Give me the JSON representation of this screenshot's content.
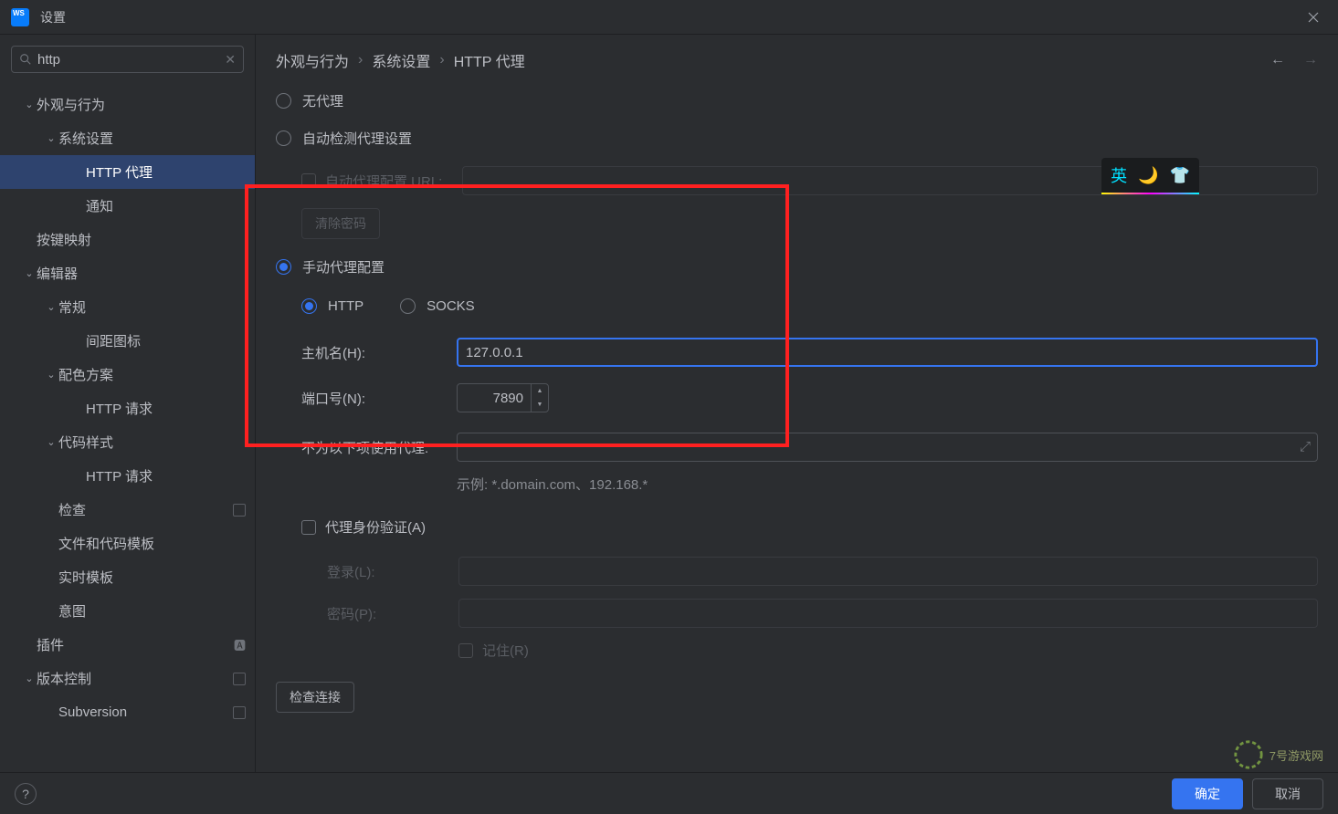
{
  "titlebar": {
    "title": "设置"
  },
  "search": {
    "value": "http"
  },
  "sidebar": {
    "items": [
      {
        "label": "外观与行为",
        "depth": 0,
        "chev": "down"
      },
      {
        "label": "系统设置",
        "depth": 1,
        "chev": "down"
      },
      {
        "label": "HTTP 代理",
        "depth": 2,
        "selected": true
      },
      {
        "label": "通知",
        "depth": 2
      },
      {
        "label": "按键映射",
        "depth": 0
      },
      {
        "label": "编辑器",
        "depth": 0,
        "chev": "down"
      },
      {
        "label": "常规",
        "depth": 1,
        "chev": "down"
      },
      {
        "label": "间距图标",
        "depth": 2
      },
      {
        "label": "配色方案",
        "depth": 1,
        "chev": "down"
      },
      {
        "label": "HTTP 请求",
        "depth": 2
      },
      {
        "label": "代码样式",
        "depth": 1,
        "chev": "down"
      },
      {
        "label": "HTTP 请求",
        "depth": 2
      },
      {
        "label": "检查",
        "depth": 1,
        "badge": true
      },
      {
        "label": "文件和代码模板",
        "depth": 1
      },
      {
        "label": "实时模板",
        "depth": 1
      },
      {
        "label": "意图",
        "depth": 1
      },
      {
        "label": "插件",
        "depth": 0,
        "lang": "⁂"
      },
      {
        "label": "版本控制",
        "depth": 0,
        "chev": "down",
        "badge": true
      },
      {
        "label": "Subversion",
        "depth": 1,
        "badge": true
      }
    ]
  },
  "breadcrumb": {
    "a": "外观与行为",
    "b": "系统设置",
    "c": "HTTP 代理"
  },
  "proxy": {
    "no_proxy": "无代理",
    "auto_detect": "自动检测代理设置",
    "auto_url_label": "自动代理配置 URL:",
    "clear_passwords": "清除密码",
    "manual": "手动代理配置",
    "http": "HTTP",
    "socks": "SOCKS",
    "host_label": "主机名(H):",
    "host_value": "127.0.0.1",
    "port_label": "端口号(N):",
    "port_value": "7890",
    "no_proxy_for_label": "不为以下项使用代理:",
    "example": "示例: *.domain.com、192.168.*",
    "auth_label": "代理身份验证(A)",
    "login_label": "登录(L):",
    "password_label": "密码(P):",
    "remember_label": "记住(R)",
    "check_connection": "检查连接"
  },
  "ime": {
    "lang": "英"
  },
  "footer": {
    "ok": "确定",
    "cancel": "取消"
  },
  "watermark": "7号游戏网"
}
